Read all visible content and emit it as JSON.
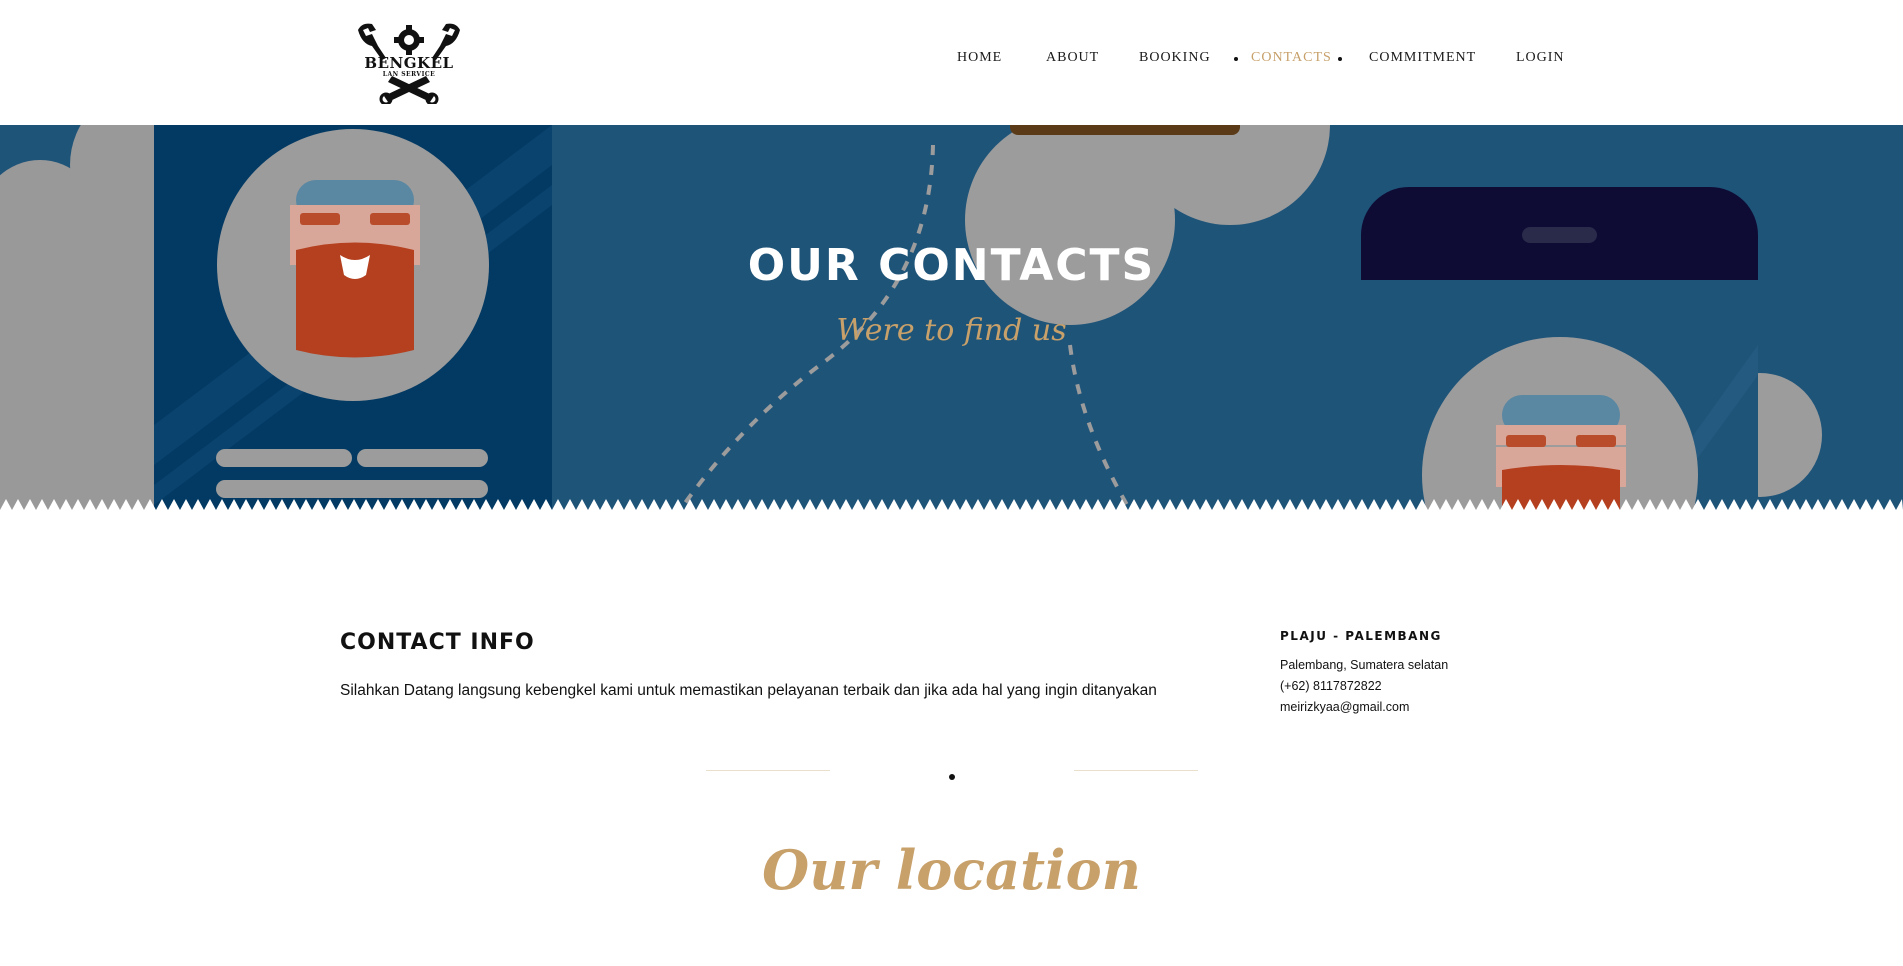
{
  "header": {
    "logo": {
      "main_text": "BENGKEL",
      "sub_text": "LAN SERVICE"
    },
    "nav": {
      "items": [
        {
          "label": "HOME"
        },
        {
          "label": "ABOUT"
        },
        {
          "label": "BOOKING"
        },
        {
          "label": "CONTACTS",
          "active": true
        },
        {
          "label": "COMMITMENT"
        },
        {
          "label": "LOGIN"
        }
      ]
    }
  },
  "hero": {
    "title": "OUR CONTACTS",
    "subtitle": "Were to find us"
  },
  "contact": {
    "title": "CONTACT INFO",
    "text": "Silahkan Datang langsung kebengkel kami untuk memastikan pelayanan terbaik dan jika ada hal yang ingin ditanyakan"
  },
  "location_info": {
    "title": "PLAJU - PALEMBANG",
    "address": "Palembang, Sumatera selatan",
    "phone": "(+62) 8117872822",
    "email": "meirizkyaa@gmail.com"
  },
  "location_section": {
    "title": "Our location"
  },
  "colors": {
    "hero_bg": "#1f5479",
    "accent_gold": "#c7a06a",
    "text_dark": "#111111"
  }
}
